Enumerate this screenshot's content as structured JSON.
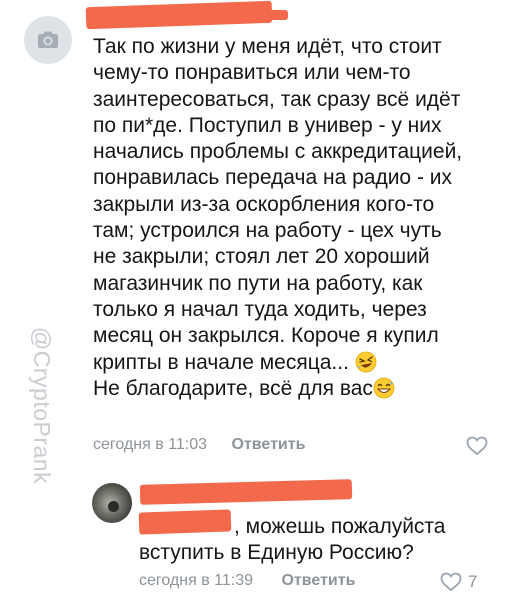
{
  "watermark": "@CryptoPrank",
  "comment1": {
    "avatar_icon": "camera-icon",
    "lines": [
      "Так по жизни у меня идёт, что стоит",
      "чему-то понравиться или чем-то",
      "заинтересоваться, так сразу всё идёт",
      "по пи*де. Поступил в универ - у них",
      "начались проблемы с аккредитацией,",
      "понравилась передача на радио - их",
      "закрыли из-за оскорбления кого-то",
      "там; устроился на работу - цех чуть",
      "не закрыли; стоял лет 20 хороший",
      "магазинчик по пути на работу, как",
      "только я начал туда ходить, через",
      "месяц он закрылся. Короче я купил",
      "крипты в начале месяца...",
      "Не благодарите, всё для вас"
    ],
    "emoji_1": "rofl-emoji",
    "emoji_2": "grin-sweat-emoji",
    "time": "сегодня в 11:03",
    "reply_label": "Ответить",
    "like_icon": "heart-icon"
  },
  "comment2": {
    "line_1_suffix": ", можешь пожалуйста",
    "line_2": "вступить в Единую Россию?",
    "time": "сегодня в 11:39",
    "reply_label": "Ответить",
    "like_icon": "heart-icon",
    "likes": "7"
  },
  "colors": {
    "redaction": "#f26a4b",
    "meta_text": "#8d9399",
    "watermark": "#c9ccd1"
  }
}
